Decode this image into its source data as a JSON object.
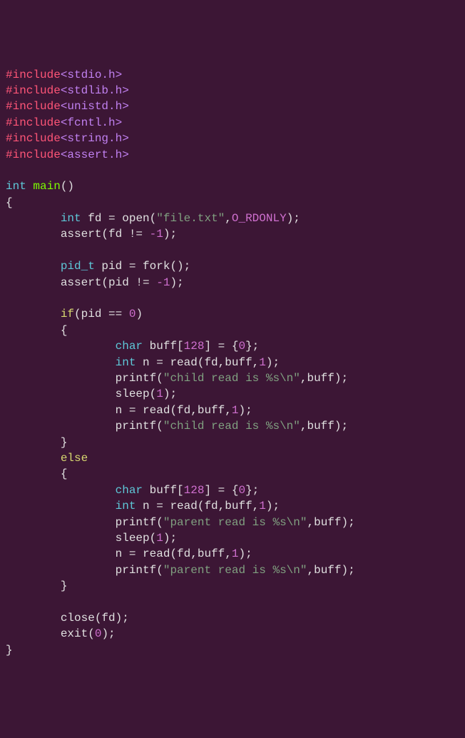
{
  "includes": [
    {
      "directive": "#include",
      "header": "<stdio.h>"
    },
    {
      "directive": "#include",
      "header": "<stdlib.h>"
    },
    {
      "directive": "#include",
      "header": "<unistd.h>"
    },
    {
      "directive": "#include",
      "header": "<fcntl.h>"
    },
    {
      "directive": "#include",
      "header": "<string.h>"
    },
    {
      "directive": "#include",
      "header": "<assert.h>"
    }
  ],
  "signature": {
    "rettype": "int",
    "name": "main",
    "params": "()"
  },
  "body": {
    "l1_type": "int",
    "l1_var": " fd = ",
    "l1_call": "open",
    "l1_open": "(",
    "l1_str": "\"file.txt\"",
    "l1_comma": ",",
    "l1_flag": "O_RDONLY",
    "l1_close": ");",
    "l2": "assert(fd != ",
    "l2_num": "-1",
    "l2_end": ");",
    "l3_type": "pid_t",
    "l3_rest": " pid = fork();",
    "l4": "assert(pid != ",
    "l4_num": "-1",
    "l4_end": ");",
    "l5_if": "if",
    "l5_cond": "(pid == ",
    "l5_zero": "0",
    "l5_close": ")",
    "child": {
      "b1_type": "char",
      "b1_rest": " buff[",
      "b1_n128": "128",
      "b1_mid": "] = {",
      "b1_zero": "0",
      "b1_end": "};",
      "b2_type": "int",
      "b2_rest": " n = read(fd,buff,",
      "b2_one": "1",
      "b2_end": ");",
      "b3_call": "printf(",
      "b3_str": "\"child read is %s\\n\"",
      "b3_end": ",buff);",
      "b4_call": "sleep(",
      "b4_one": "1",
      "b4_end": ");",
      "b5": "n = read(fd,buff,",
      "b5_one": "1",
      "b5_end": ");",
      "b6_call": "printf(",
      "b6_str": "\"child read is %s\\n\"",
      "b6_end": ",buff);"
    },
    "elsekw": "else",
    "parent": {
      "b1_type": "char",
      "b1_rest": " buff[",
      "b1_n128": "128",
      "b1_mid": "] = {",
      "b1_zero": "0",
      "b1_end": "};",
      "b2_type": "int",
      "b2_rest": " n = read(fd,buff,",
      "b2_one": "1",
      "b2_end": ");",
      "b3_call": "printf(",
      "b3_str": "\"parent read is %s\\n\"",
      "b3_end": ",buff);",
      "b4_call": "sleep(",
      "b4_one": "1",
      "b4_end": ");",
      "b5": "n = read(fd,buff,",
      "b5_one": "1",
      "b5_end": ");",
      "b6_call": "printf(",
      "b6_str": "\"parent read is %s\\n\"",
      "b6_end": ",buff);"
    },
    "close_call": "close(fd);",
    "exit_call": "exit(",
    "exit_zero": "0",
    "exit_end": ");"
  },
  "braces": {
    "open": "{",
    "close": "}"
  }
}
